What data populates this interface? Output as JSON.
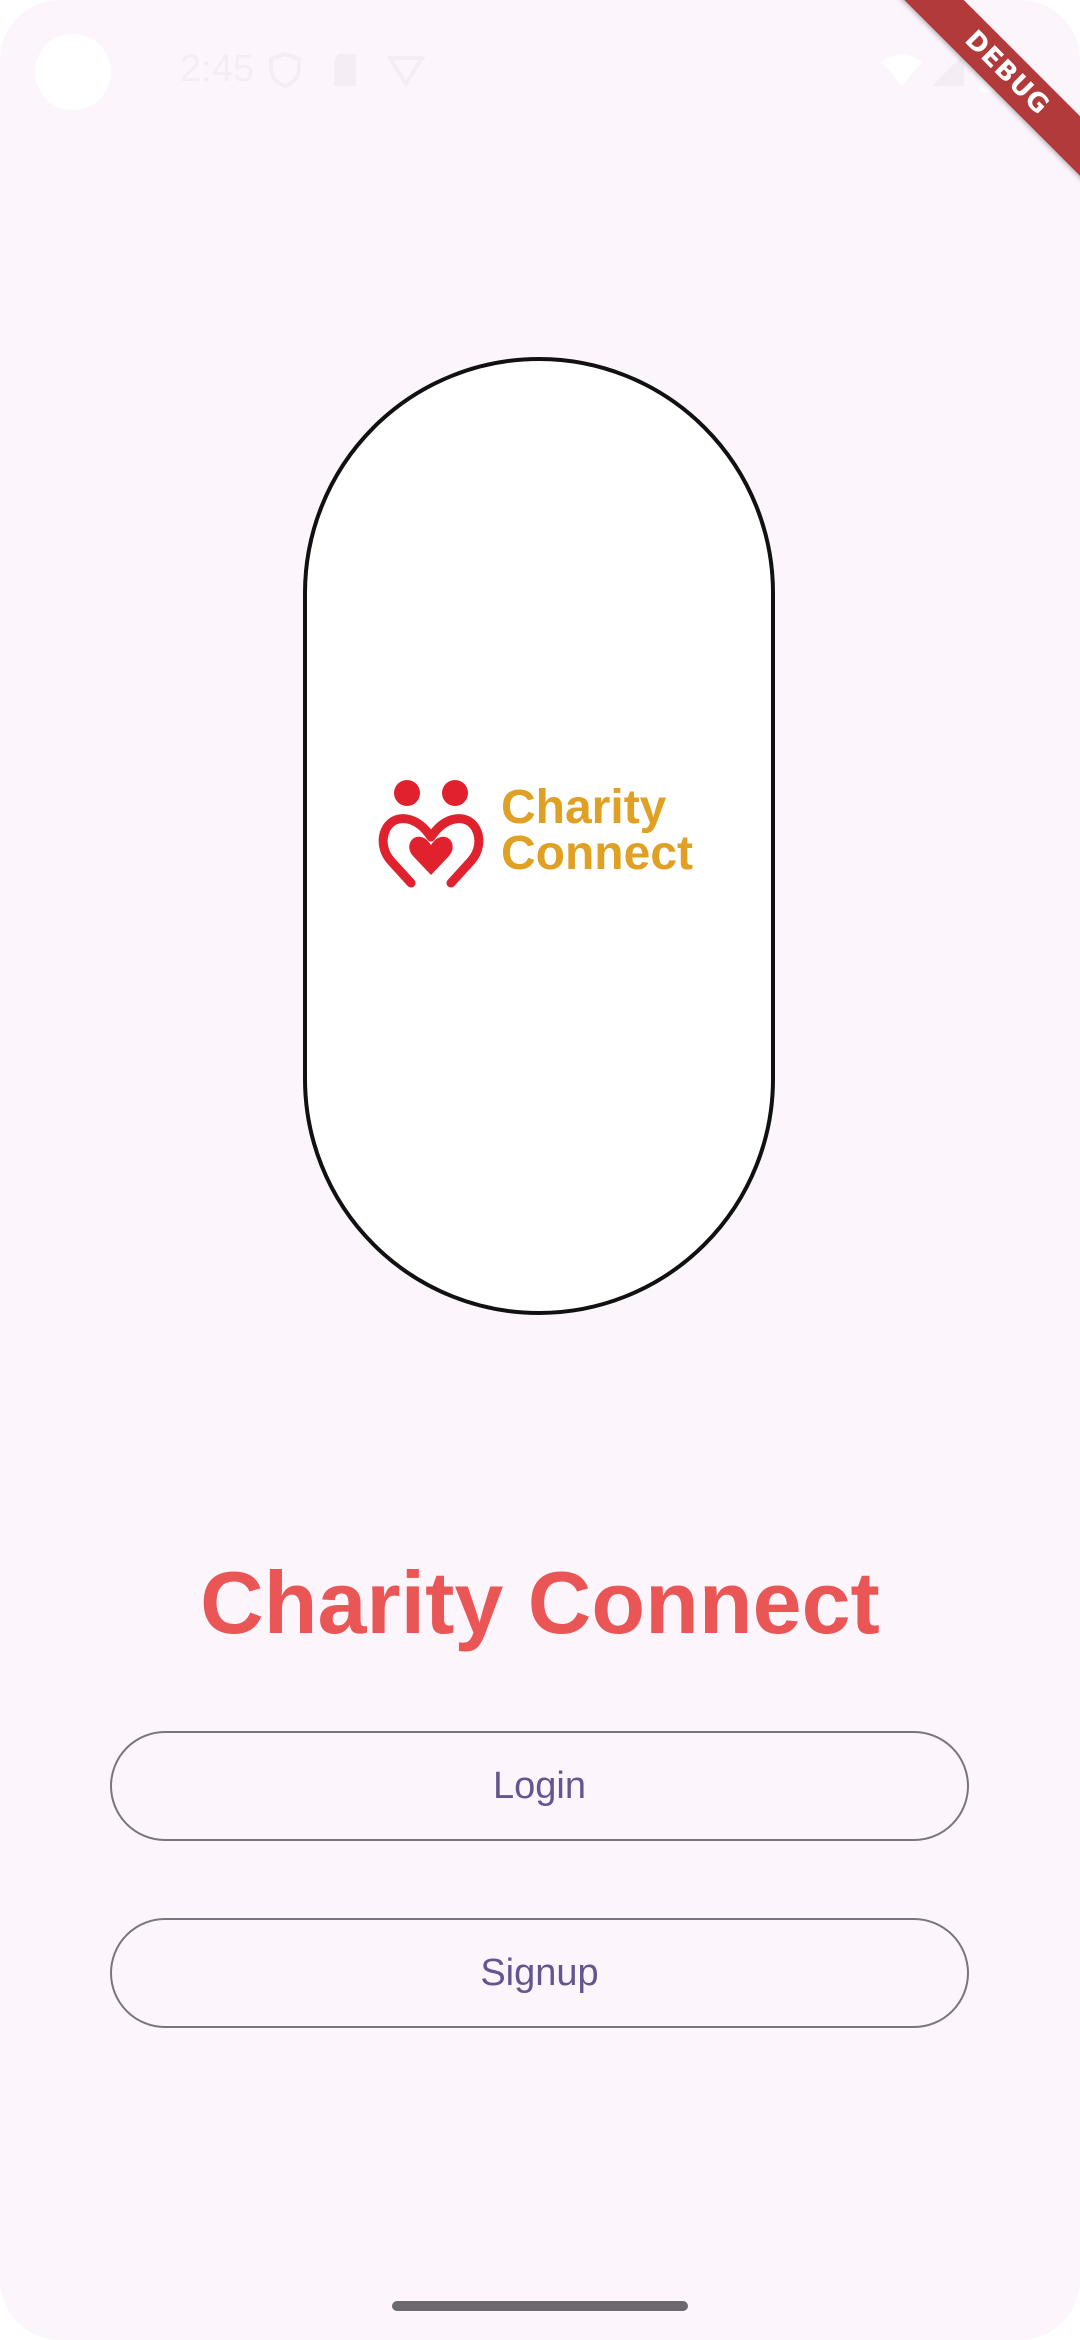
{
  "status_bar": {
    "time": "2:45",
    "icons": [
      "shield-icon",
      "sd-card-icon",
      "vpn-icon",
      "wifi-icon",
      "cell-signal-icon",
      "battery-icon"
    ]
  },
  "debug_banner": "DEBUG",
  "logo": {
    "line1": "Charity",
    "line2": "Connect",
    "mark_color": "#e0222e",
    "text_color": "#e0a024"
  },
  "title": "Charity Connect",
  "buttons": {
    "login": "Login",
    "signup": "Signup"
  },
  "colors": {
    "background": "#fcf5fc",
    "title": "#ea5555",
    "button_text": "#65558f",
    "button_border": "#79747e"
  }
}
